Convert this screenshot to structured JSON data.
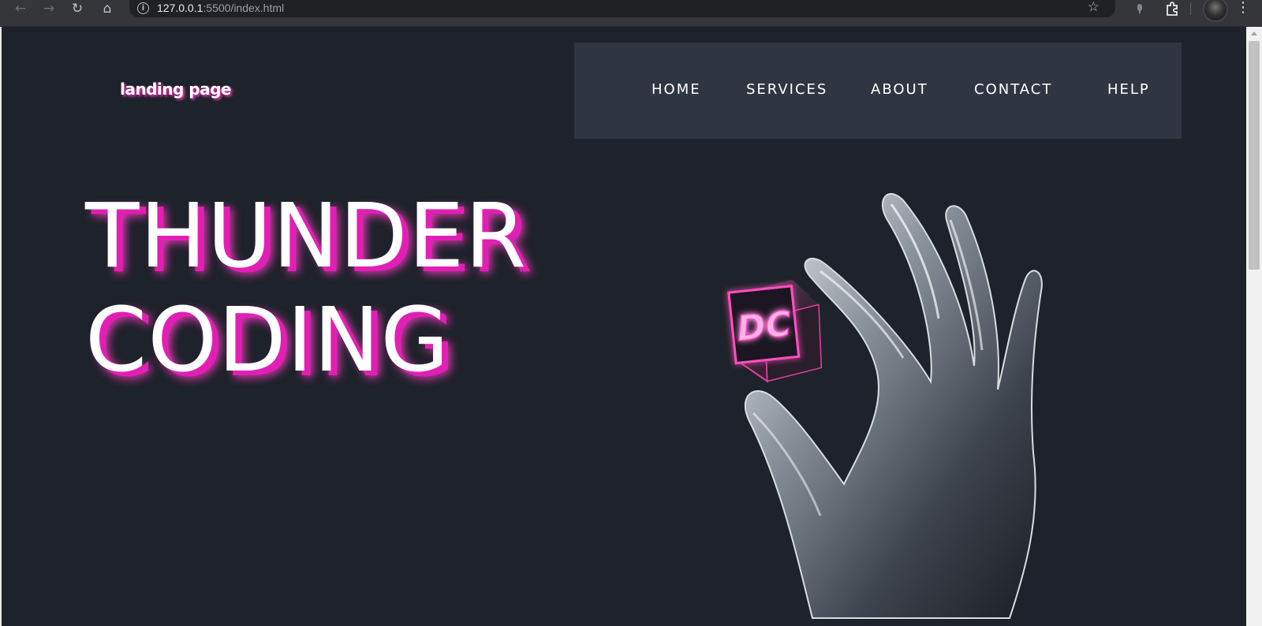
{
  "browser": {
    "url_host": "127.0.0.1",
    "url_path": ":5500/index.html",
    "icons": {
      "back": "arrow-left-icon",
      "forward": "arrow-right-icon",
      "reload": "reload-icon",
      "home": "home-icon",
      "site_info": "info-icon",
      "bookmark": "star-icon",
      "extension": "puzzle-icon",
      "menu": "kebab-menu-icon"
    }
  },
  "page": {
    "logo": "landing page",
    "nav": {
      "home": "HOME",
      "services": "SERVICES",
      "about": "ABOUT",
      "contact": "CONTACT",
      "help": "HELP"
    },
    "hero": {
      "line1": "THUNDER",
      "line2": "CODING"
    },
    "cube_label": "DC"
  },
  "colors": {
    "page_background": "#1e222a",
    "navbar_background": "#2f3642",
    "accent_glow": "#ff3ec8",
    "text": "#ffffff"
  }
}
